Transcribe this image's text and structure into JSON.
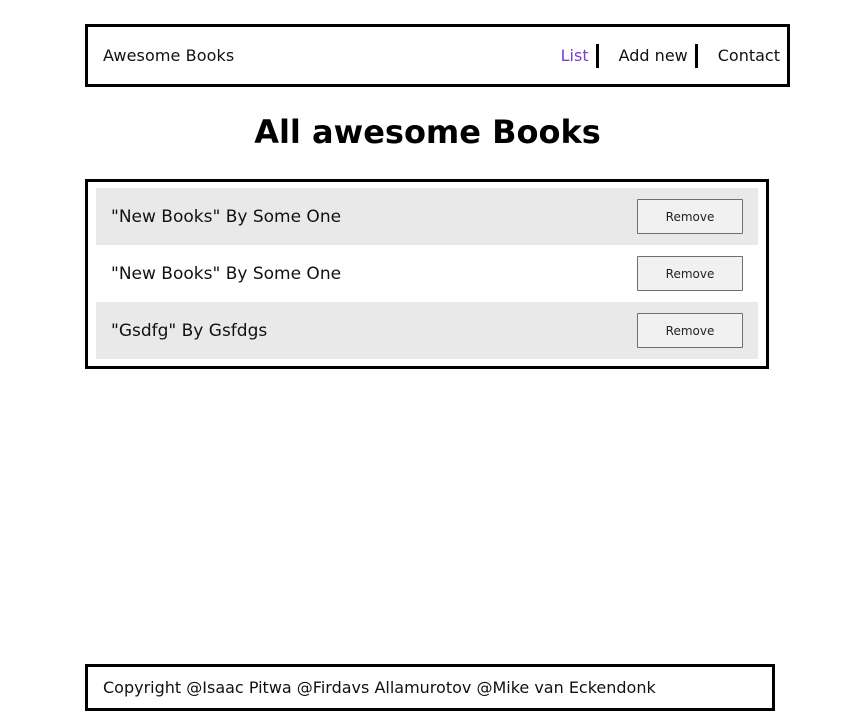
{
  "header": {
    "brand": "Awesome Books",
    "nav": [
      {
        "label": "List",
        "active": true
      },
      {
        "label": "Add new",
        "active": false
      },
      {
        "label": "Contact",
        "active": false
      }
    ]
  },
  "main": {
    "title": "All awesome Books",
    "books": [
      {
        "text": "\"New Books\" By Some One",
        "remove_label": "Remove"
      },
      {
        "text": "\"New Books\" By Some One",
        "remove_label": "Remove"
      },
      {
        "text": "\"Gsdfg\" By Gsfdgs",
        "remove_label": "Remove"
      }
    ]
  },
  "footer": {
    "copyright": "Copyright @Isaac Pitwa @Firdavs Allamurotov @Mike van Eckendonk"
  },
  "colors": {
    "active_nav": "#7a3fd3",
    "row_shade": "#e9e9e9",
    "border": "#000000"
  }
}
